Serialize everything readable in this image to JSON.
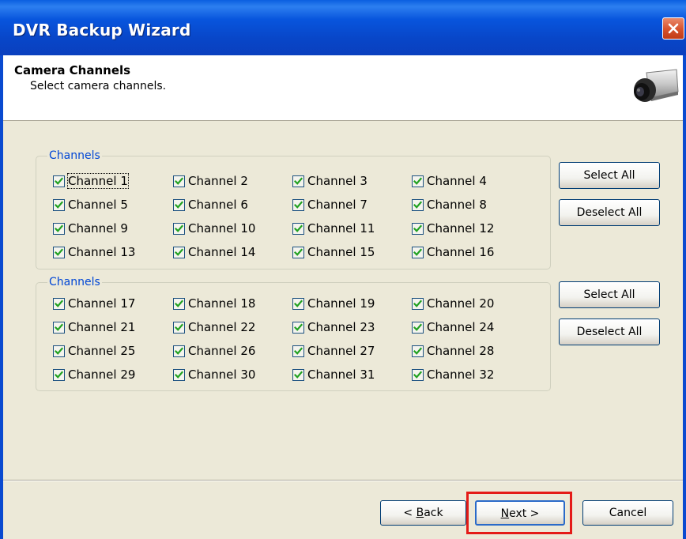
{
  "window": {
    "title": "DVR Backup Wizard"
  },
  "header": {
    "title": "Camera Channels",
    "subtitle": "Select camera channels."
  },
  "groups": [
    {
      "legend": "Channels",
      "select_all": "Select All",
      "deselect_all": "Deselect All",
      "channels": [
        {
          "label": "Channel 1",
          "checked": true
        },
        {
          "label": "Channel 2",
          "checked": true
        },
        {
          "label": "Channel 3",
          "checked": true
        },
        {
          "label": "Channel 4",
          "checked": true
        },
        {
          "label": "Channel 5",
          "checked": true
        },
        {
          "label": "Channel 6",
          "checked": true
        },
        {
          "label": "Channel 7",
          "checked": true
        },
        {
          "label": "Channel 8",
          "checked": true
        },
        {
          "label": "Channel 9",
          "checked": true
        },
        {
          "label": "Channel 10",
          "checked": true
        },
        {
          "label": "Channel 11",
          "checked": true
        },
        {
          "label": "Channel 12",
          "checked": true
        },
        {
          "label": "Channel 13",
          "checked": true
        },
        {
          "label": "Channel 14",
          "checked": true
        },
        {
          "label": "Channel 15",
          "checked": true
        },
        {
          "label": "Channel 16",
          "checked": true
        }
      ]
    },
    {
      "legend": "Channels",
      "select_all": "Select All",
      "deselect_all": "Deselect All",
      "channels": [
        {
          "label": "Channel 17",
          "checked": true
        },
        {
          "label": "Channel 18",
          "checked": true
        },
        {
          "label": "Channel 19",
          "checked": true
        },
        {
          "label": "Channel 20",
          "checked": true
        },
        {
          "label": "Channel 21",
          "checked": true
        },
        {
          "label": "Channel 22",
          "checked": true
        },
        {
          "label": "Channel 23",
          "checked": true
        },
        {
          "label": "Channel 24",
          "checked": true
        },
        {
          "label": "Channel 25",
          "checked": true
        },
        {
          "label": "Channel 26",
          "checked": true
        },
        {
          "label": "Channel 27",
          "checked": true
        },
        {
          "label": "Channel 28",
          "checked": true
        },
        {
          "label": "Channel 29",
          "checked": true
        },
        {
          "label": "Channel 30",
          "checked": true
        },
        {
          "label": "Channel 31",
          "checked": true
        },
        {
          "label": "Channel 32",
          "checked": true
        }
      ]
    }
  ],
  "footer": {
    "back": {
      "pre": "< ",
      "mnemonic": "B",
      "post": "ack"
    },
    "next": {
      "pre": "",
      "mnemonic": "N",
      "post": "ext >"
    },
    "cancel": "Cancel"
  },
  "colors": {
    "title_bar": "#0855dd",
    "dialog_bg": "#ece9d8",
    "legend_text": "#0046d5",
    "check_mark": "#21a121",
    "highlight": "#e41b17"
  },
  "icons": {
    "close": "close-icon",
    "header_image": "camera-icon",
    "checkbox": "checkmark-icon"
  }
}
